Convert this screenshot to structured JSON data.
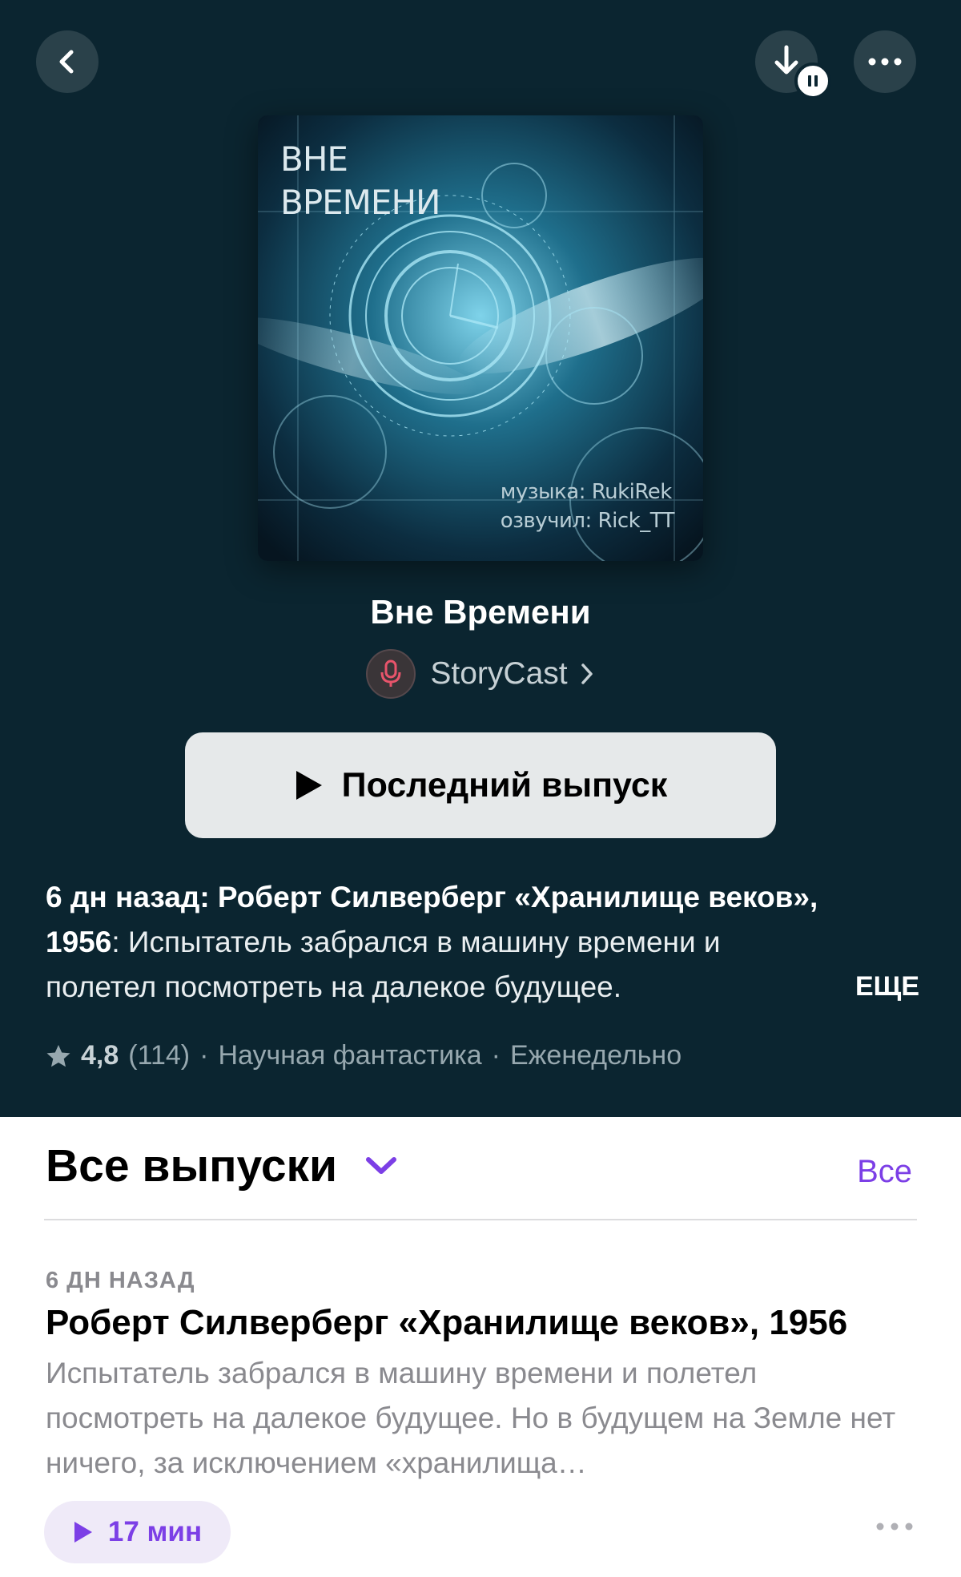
{
  "nav": {
    "back_icon": "chevron-left-icon",
    "download_icon": "download-icon",
    "download_status_icon": "pause-icon",
    "more_icon": "ellipsis-icon"
  },
  "cover": {
    "title_line1": "ВНЕ",
    "title_line2": "ВРЕМЕНИ",
    "credit_music": "музыка: RukiRek",
    "credit_voice": "озвучил: Rick_TT"
  },
  "show": {
    "title": "Вне Времени",
    "author": "StoryCast",
    "play_latest_label": "Последний выпуск"
  },
  "summary": {
    "lead": "6 дн назад: Роберт Силверберг «Хранилище веков», 1956",
    "text": ": Испытатель забрался в машину времени и полетел посмотреть на далекое будущее.",
    "more_label": "ЕЩЕ"
  },
  "meta": {
    "rating": "4,8",
    "rating_count": "(114)",
    "separator": "·",
    "genre": "Научная фантастика",
    "frequency": "Еженедельно"
  },
  "episodes_section": {
    "title": "Все выпуски",
    "see_all": "Все"
  },
  "episode": {
    "date": "6 ДН НАЗАД",
    "title": "Роберт Силверберг «Хранилище веков», 1956",
    "description": "Испытатель забрался в машину времени и полетел посмотреть на далекое будущее. Но в будущем на Земле нет ничего, за исключением «хранилища…",
    "duration": "17 мин"
  },
  "colors": {
    "hero_bg": "#0b2530",
    "accent": "#7c3fe6",
    "play_button_bg": "#e6e9ea"
  }
}
